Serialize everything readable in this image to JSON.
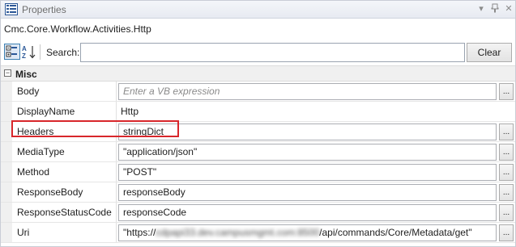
{
  "window": {
    "title": "Properties",
    "icons": {
      "title": "properties-grid-icon",
      "dropdown": "dropdown-arrow-icon",
      "pin": "pin-icon",
      "close": "close-icon"
    }
  },
  "type_name": "Cmc.Core.Workflow.Activities.Http",
  "toolbar": {
    "categorized_icon": "categorized-sort-icon",
    "alphabetical_icon": "alphabetical-sort-icon",
    "search_label": "Search:",
    "search_value": "",
    "clear_label": "Clear"
  },
  "category": {
    "label": "Misc",
    "collapse_symbol": "⊟"
  },
  "properties": [
    {
      "name": "Body",
      "value": "",
      "placeholder": "Enter a VB expression",
      "has_box": true,
      "has_ellipsis": true
    },
    {
      "name": "DisplayName",
      "value": "Http",
      "has_box": false,
      "has_ellipsis": false
    },
    {
      "name": "Headers",
      "value": "stringDict",
      "has_box": true,
      "has_ellipsis": true,
      "highlighted": true
    },
    {
      "name": "MediaType",
      "value": "\"application/json\"",
      "has_box": true,
      "has_ellipsis": true
    },
    {
      "name": "Method",
      "value": "\"POST\"",
      "has_box": true,
      "has_ellipsis": true
    },
    {
      "name": "ResponseBody",
      "value": "responseBody",
      "has_box": true,
      "has_ellipsis": true
    },
    {
      "name": "ResponseStatusCode",
      "value": "responseCode",
      "has_box": true,
      "has_ellipsis": true
    },
    {
      "name": "Uri",
      "value_prefix": "\"https://",
      "value_blurred": "cdpapi33.dev.campusmgmt.com:8500",
      "value_suffix": "/api/commands/Core/Metadata/get\"",
      "has_box": true,
      "has_ellipsis": true
    }
  ],
  "ellipsis_label": "...",
  "colors": {
    "highlight": "#d8262b",
    "accent": "#3c7fb1"
  }
}
